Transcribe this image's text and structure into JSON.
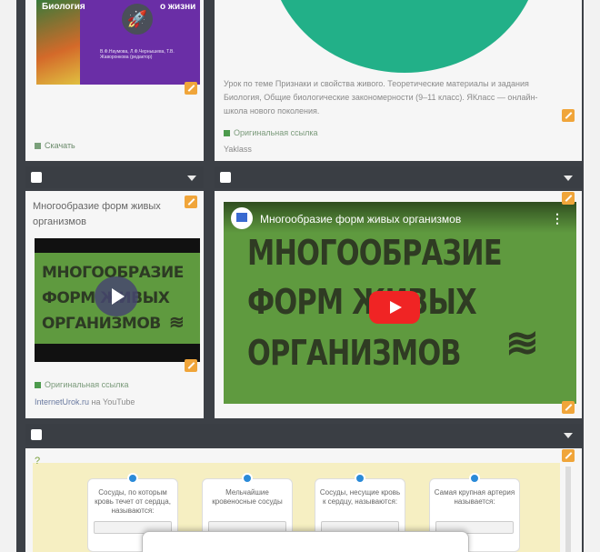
{
  "row1": {
    "book": {
      "title_left": "Биология",
      "title_right": "о жизни",
      "authors": "В.Ф.Наумова, Л.Ф.Чернышева, Т.В. Жаворонкова (редактор)",
      "download_label": "Скачать"
    },
    "article": {
      "description": "Урок по теме Признаки и свойства живого. Теоретические материалы и задания Биология, Общие биологические закономерности (9–11 класс). ЯКласс — онлайн-школа нового поколения.",
      "link_label": "Оригинальная ссылка",
      "source": "Yaklass"
    }
  },
  "row2": {
    "left_card": {
      "title": "Многообразие форм живых организмов",
      "thumb_lines": [
        "МНОГООБРАЗИЕ",
        "ФОРМ ЖИВЫХ",
        "ОРГАНИЗМОВ"
      ],
      "link_label": "Оригинальная ссылка",
      "source_site": "InternetUrok.ru",
      "source_suffix": "на YouTube"
    },
    "player": {
      "title": "Многообразие форм живых организмов",
      "big_lines": [
        "МНОГООБРАЗИЕ",
        "ФОРМ ЖИВЫХ",
        "ОРГАНИЗМОВ"
      ]
    }
  },
  "quiz": {
    "cards": [
      "Сосуды, по которым кровь течет от сердца, называются:",
      "Мельчайшие кровеносные сосуды",
      "Сосуды, несущие кровь к сердцу, называются:",
      "Самая крупная артерия называется:"
    ]
  },
  "colors": {
    "board": "#3c4046",
    "pencil": "#f0a53a",
    "teal": "#22b088",
    "video_green": "#5f9a3f",
    "youtube_red": "#f02424",
    "quiz_bg": "#f6efc2",
    "quiz_dot": "#2a8ad8"
  },
  "icons": [
    "edit-pencil-icon",
    "checkbox-icon",
    "chevron-down-icon",
    "play-icon",
    "youtube-play-icon",
    "dna-icon",
    "download-icon",
    "link-icon",
    "more-vert-icon",
    "rocket-icon"
  ]
}
